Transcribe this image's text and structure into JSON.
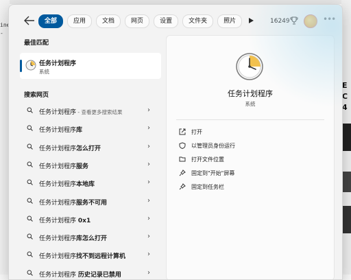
{
  "tabs": [
    "全部",
    "应用",
    "文档",
    "网页",
    "设置",
    "文件夹",
    "照片"
  ],
  "points": "16249",
  "best_match": {
    "section_title": "最佳匹配",
    "name": "任务计划程序",
    "type": "系统"
  },
  "web_search": {
    "section_title": "搜索网页",
    "items": [
      {
        "prefix": "任务计划程序",
        "bold": "",
        "suffix": " - 查看更多搜索结果"
      },
      {
        "prefix": "任务计划程序",
        "bold": "库",
        "suffix": ""
      },
      {
        "prefix": "任务计划程序",
        "bold": "怎么打开",
        "suffix": ""
      },
      {
        "prefix": "任务计划程序",
        "bold": "服务",
        "suffix": ""
      },
      {
        "prefix": "任务计划程序",
        "bold": "本地库",
        "suffix": ""
      },
      {
        "prefix": "任务计划程序",
        "bold": "服务不可用",
        "suffix": ""
      },
      {
        "prefix": "任务计划程序 ",
        "bold": "0x1",
        "suffix": ""
      },
      {
        "prefix": "任务计划程序",
        "bold": "库怎么打开",
        "suffix": ""
      },
      {
        "prefix": "任务计划程序",
        "bold": "找不到远程计算机",
        "suffix": ""
      },
      {
        "prefix": "任务计划程序 ",
        "bold": "历史记录已禁用",
        "suffix": ""
      }
    ]
  },
  "detail": {
    "name": "任务计划程序",
    "type": "系统",
    "actions": [
      "打开",
      "以管理员身份运行",
      "打开文件位置",
      "固定到\"开始\"屏幕",
      "固定到任务栏"
    ]
  },
  "background": {
    "left_text": [
      "ine",
      "-"
    ],
    "right_text": [
      "E",
      "C",
      "4"
    ]
  }
}
